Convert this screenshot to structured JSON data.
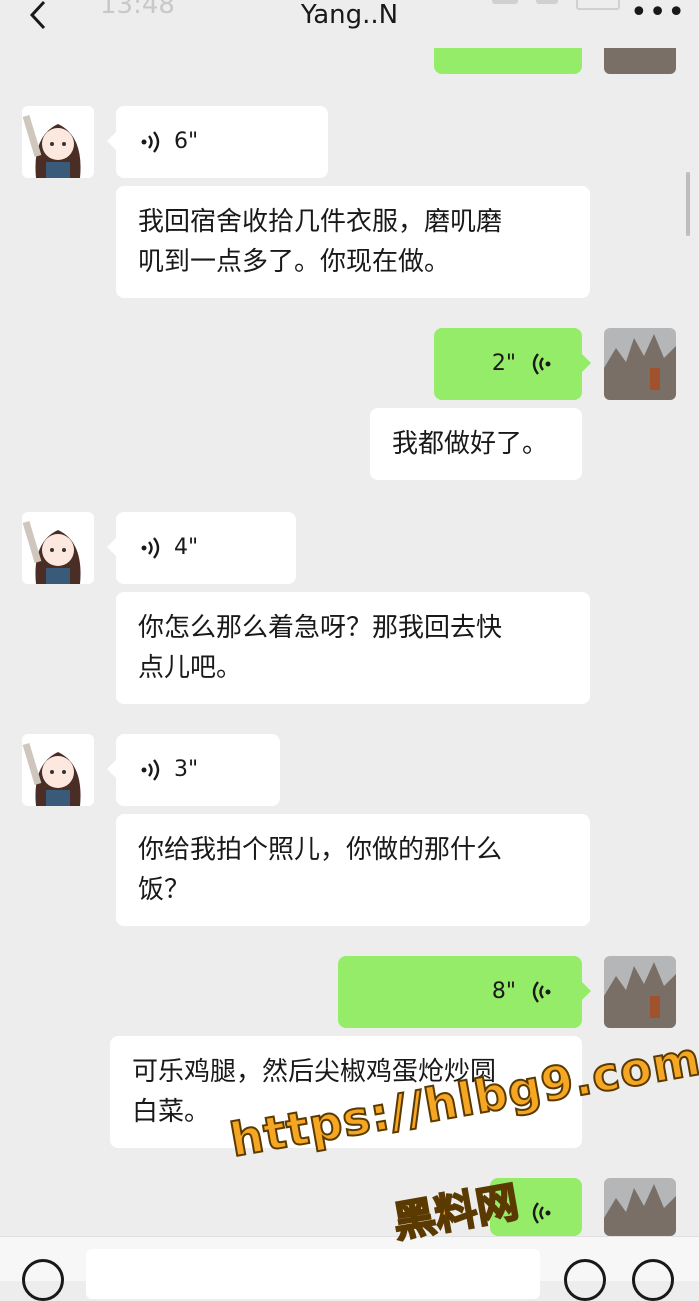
{
  "header": {
    "title": "Yang..N",
    "status_time": "13:48"
  },
  "colors": {
    "background": "#ededed",
    "self_bubble": "#95ec69",
    "other_bubble": "#ffffff",
    "watermark": "#f5a623"
  },
  "messages": [
    {
      "from": "other",
      "type": "voice",
      "duration": "6\""
    },
    {
      "from": "other",
      "type": "text",
      "lines": [
        "我回宿舍收拾几件衣服，磨叽磨",
        "叽到一点多了。你现在做。"
      ]
    },
    {
      "from": "self",
      "type": "voice",
      "duration": "2\""
    },
    {
      "from": "self",
      "type": "text",
      "lines": [
        "我都做好了。"
      ]
    },
    {
      "from": "other",
      "type": "voice",
      "duration": "4\""
    },
    {
      "from": "other",
      "type": "text",
      "lines": [
        "你怎么那么着急呀？那我回去快",
        "点儿吧。"
      ]
    },
    {
      "from": "other",
      "type": "voice",
      "duration": "3\""
    },
    {
      "from": "other",
      "type": "text",
      "lines": [
        "你给我拍个照儿，你做的那什么",
        "饭？"
      ]
    },
    {
      "from": "self",
      "type": "voice",
      "duration": "8\""
    },
    {
      "from": "self",
      "type": "text",
      "lines": [
        "可乐鸡腿，然后尖椒鸡蛋炝炒圆",
        "白菜。"
      ]
    }
  ],
  "watermark": {
    "url": "https://hlbg9.com",
    "name": "黑料网"
  }
}
